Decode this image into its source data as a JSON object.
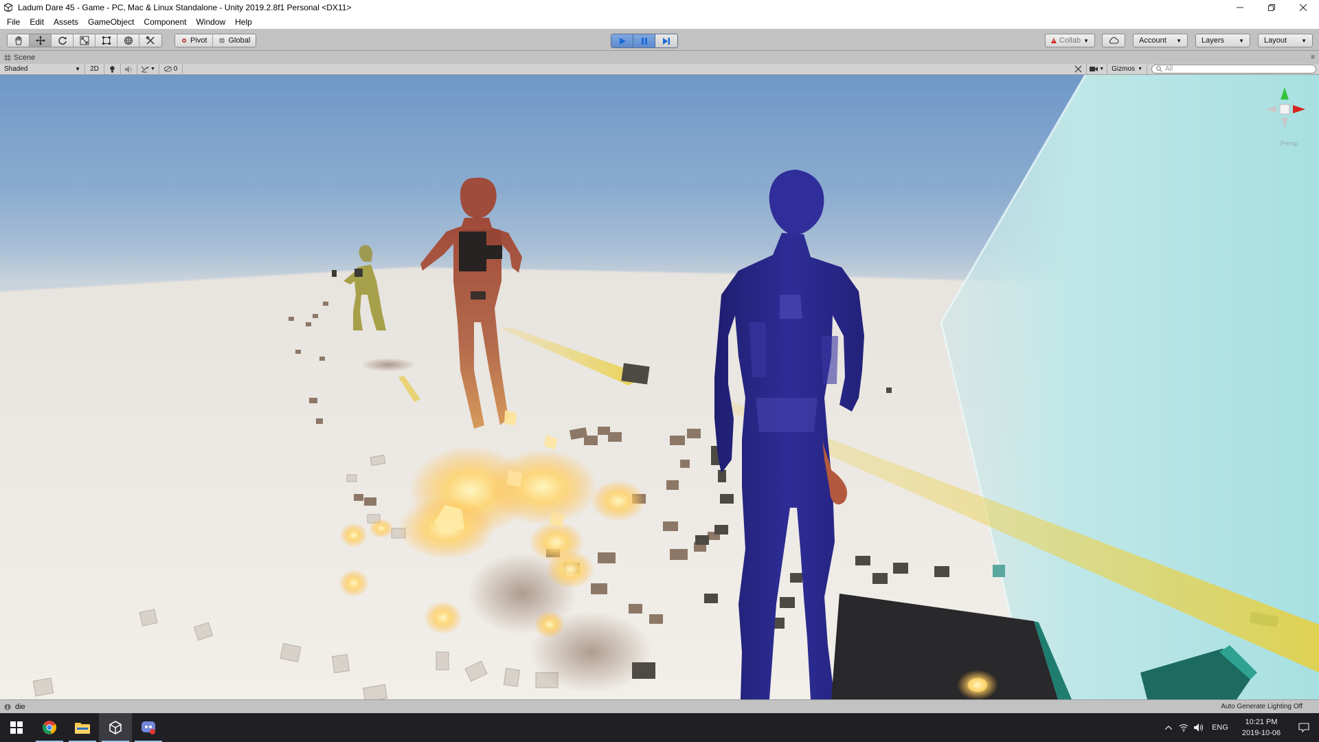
{
  "window": {
    "title": "Ladum Dare 45 - Game - PC, Mac & Linux Standalone - Unity 2019.2.8f1 Personal <DX11>",
    "controls": [
      "minimize",
      "restore",
      "close"
    ]
  },
  "menu": [
    "File",
    "Edit",
    "Assets",
    "GameObject",
    "Component",
    "Window",
    "Help"
  ],
  "toolbar": {
    "tools": [
      "hand-tool",
      "move-tool",
      "rotate-tool",
      "scale-tool",
      "rect-tool",
      "transform-tool",
      "custom-tool"
    ],
    "active_tool": "move-tool",
    "pivot_label": "Pivot",
    "global_label": "Global",
    "playback": [
      "play",
      "pause",
      "step"
    ],
    "collab_label": "Collab",
    "account_label": "Account",
    "layers_label": "Layers",
    "layout_label": "Layout"
  },
  "scene": {
    "tab_label": "Scene",
    "shading_mode": "Shaded",
    "mode_2d": "2D",
    "hidden_count": "0",
    "gizmos_label": "Gizmos",
    "search_placeholder": "All",
    "persp_label": "Persp"
  },
  "status": {
    "message": "die",
    "lighting": "Auto Generate Lighting Off"
  },
  "taskbar": {
    "apps": [
      "start",
      "chrome",
      "file-explorer",
      "unity",
      "discord"
    ],
    "language": "ENG",
    "time": "10:21 PM",
    "date": "2019-10-06"
  },
  "colors": {
    "editor_gray": "#c2c2c2",
    "play_blue": "#5e8bcf",
    "sky_top": "#7fa2cb",
    "ground": "#f1eeea",
    "blue_figure": "#2b2a8c",
    "red_figure": "#a85440",
    "yellow_figure": "#a7a04a",
    "laser": "#f3d86a"
  }
}
